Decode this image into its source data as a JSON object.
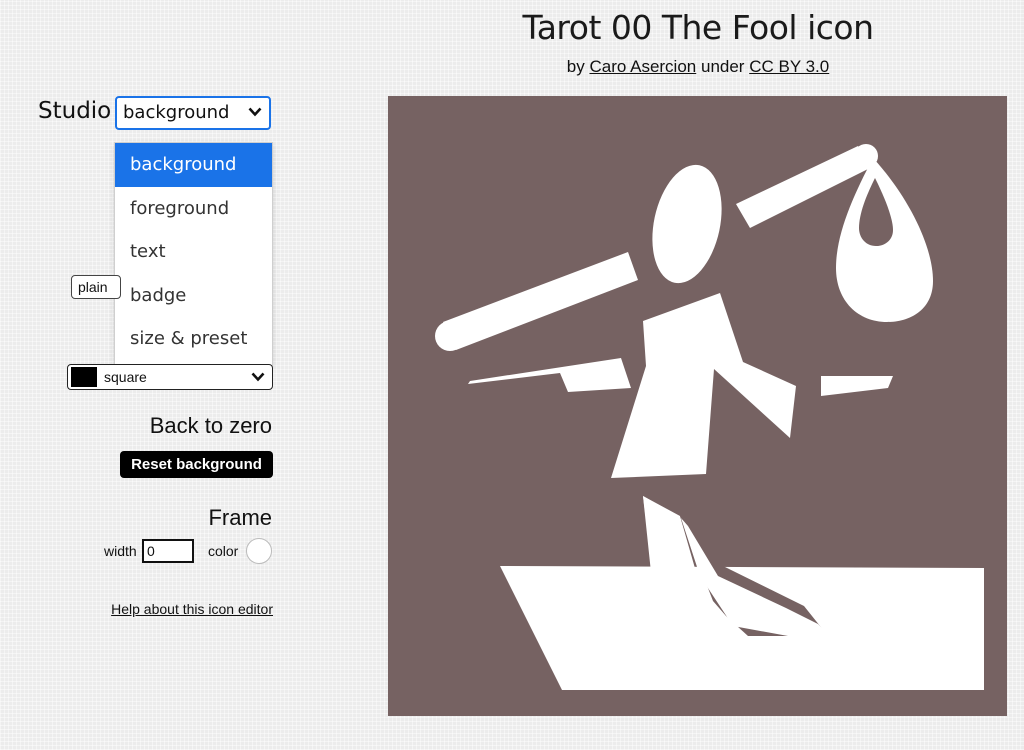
{
  "header": {
    "title": "Tarot 00 The Fool icon",
    "credit_by": "by",
    "author": "Caro Asercion",
    "credit_under": "under",
    "license": "CC BY 3.0"
  },
  "studio": {
    "label": "Studio",
    "selected": "background",
    "options": [
      "background",
      "foreground",
      "text",
      "badge",
      "size & preset"
    ]
  },
  "background": {
    "style_value": "plain",
    "shape_value": "square",
    "back_to_zero_label": "Back to zero",
    "reset_button": "Reset background"
  },
  "frame": {
    "label": "Frame",
    "width_label": "width",
    "width_value": "0",
    "color_label": "color"
  },
  "help_link": "Help about this icon editor",
  "colors": {
    "icon_background": "#766262",
    "icon_foreground": "#ffffff",
    "accent": "#1a73e8",
    "frame_color": "#ffffff"
  },
  "icon": {
    "name": "tarot-00-the-fool-icon"
  }
}
